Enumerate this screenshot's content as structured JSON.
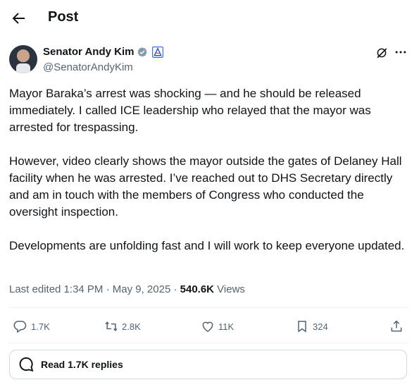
{
  "header": {
    "title": "Post"
  },
  "author": {
    "name": "Senator Andy Kim",
    "handle": "@SenatorAndyKim"
  },
  "tweet": {
    "paragraphs": [
      "Mayor Baraka’s arrest was shocking — and he should be released immediately. I called ICE leadership who relayed that the mayor was arrested for trespassing.",
      "However, video clearly shows the mayor outside the gates of Delaney Hall facility when he was arrested. I’ve reached out to DHS Secretary directly and am in touch with the members of Congress who conducted the oversight inspection.",
      "Developments are unfolding fast and I will work to keep everyone updated."
    ]
  },
  "meta": {
    "edited_label": "Last edited 1:34 PM · May 9, 2025 · ",
    "views_count": "540.6K",
    "views_label": " Views"
  },
  "actions": {
    "replies": "1.7K",
    "reposts": "2.8K",
    "likes": "11K",
    "bookmarks": "324"
  },
  "replies_button": {
    "label": "Read 1.7K replies"
  },
  "colors": {
    "text": "#0f1419",
    "secondary": "#536471",
    "verified": "#829aab",
    "affiliate": "#1d4ed8"
  }
}
